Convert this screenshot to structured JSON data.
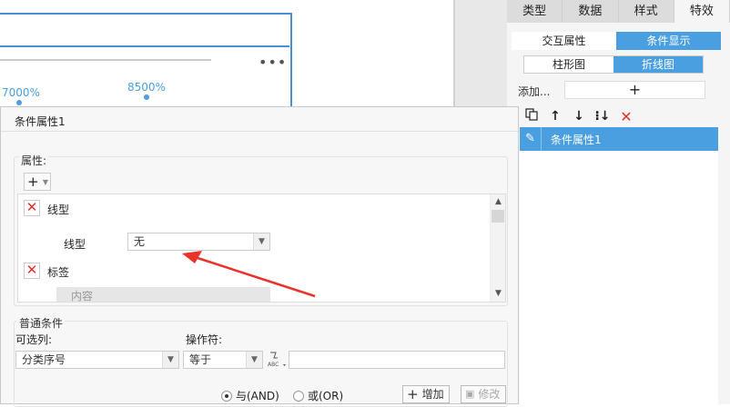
{
  "canvas": {
    "labels": [
      "7000%",
      "8500%"
    ],
    "more_icon": "•••"
  },
  "right_panel": {
    "tabs": [
      {
        "label": "类型",
        "active": false
      },
      {
        "label": "数据",
        "active": false
      },
      {
        "label": "样式",
        "active": false
      },
      {
        "label": "特效",
        "active": true
      }
    ],
    "subtabs": [
      {
        "label": "交互属性",
        "active": false
      },
      {
        "label": "条件显示",
        "active": true
      }
    ],
    "chart_tabs": [
      {
        "label": "柱形图",
        "active": false
      },
      {
        "label": "折线图",
        "active": true
      }
    ],
    "add_label": "添加...",
    "add_button": "+",
    "toolbar_icons": [
      "copy-icon",
      "arrow-up-icon",
      "arrow-down-icon",
      "sort-down-icon",
      "delete-icon"
    ],
    "list_items": [
      "条件属性1"
    ]
  },
  "dialog": {
    "title": "条件属性1",
    "attributes_label": "属性:",
    "attributes": [
      {
        "name": "线型",
        "field_label": "线型",
        "value": "无"
      },
      {
        "name": "标签",
        "field_label": "",
        "value": "内容"
      }
    ],
    "common_conditions_label": "普通条件",
    "optional_column_label": "可选列:",
    "optional_column_value": "分类序号",
    "operator_label": "操作符:",
    "operator_value": "等于",
    "value_input": "",
    "radio_and": "与(AND)",
    "radio_or": "或(OR)",
    "add_button": "增加",
    "modify_button": "修改"
  },
  "colors": {
    "accent": "#4a9fe0",
    "delete_red": "#e0312f",
    "annotation_arrow": "#e8332a"
  }
}
